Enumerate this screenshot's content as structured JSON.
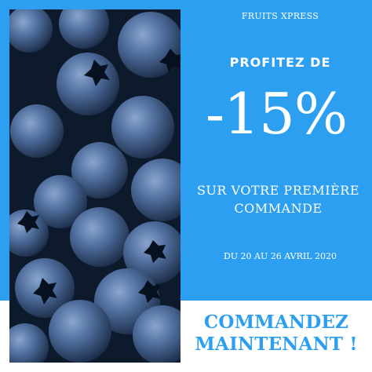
{
  "colors": {
    "accent": "#2d9ff0",
    "background": "#ffffff",
    "photo_dark": "#0d1a2c",
    "berry": "#4f6d9c"
  },
  "brand": "FRUITS XPRESS",
  "promo": {
    "intro": "PROFITEZ DE",
    "discount": "-15%",
    "subtitle_line1": "SUR VOTRE PREMIÈRE",
    "subtitle_line2": "COMMANDE",
    "dates": "DU 20 AU 26 AVRIL 2020"
  },
  "cta": {
    "line1": "COMMANDEZ",
    "line2": "MAINTENANT !"
  },
  "image": {
    "subject": "blueberries-photo"
  }
}
